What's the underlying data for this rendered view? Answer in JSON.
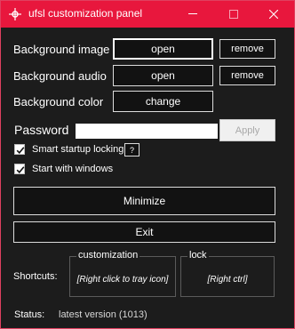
{
  "window": {
    "title": "ufsl customization panel"
  },
  "settings": {
    "background_image": {
      "label": "Background image",
      "open_label": "open",
      "remove_label": "remove"
    },
    "background_audio": {
      "label": "Background audio",
      "open_label": "open",
      "remove_label": "remove"
    },
    "background_color": {
      "label": "Background color",
      "change_label": "change"
    }
  },
  "password": {
    "label": "Password",
    "value": "",
    "apply_label": "Apply"
  },
  "options": {
    "smart_startup": {
      "label": "Smart startup locking",
      "checked": true,
      "help_label": "?"
    },
    "start_with_windows": {
      "label": "Start with windows",
      "checked": true
    }
  },
  "actions": {
    "minimize_label": "Minimize",
    "exit_label": "Exit"
  },
  "shortcuts": {
    "label": "Shortcuts:",
    "customization": {
      "title": "customization",
      "value": "[Right click to tray icon]"
    },
    "lock": {
      "title": "lock",
      "value": "[Right ctrl]"
    }
  },
  "status": {
    "label": "Status:",
    "value": "latest version (1013)"
  },
  "colors": {
    "titlebar": "#e8173d",
    "background": "#1c1c1c",
    "button_border": "#dcdcdc"
  }
}
